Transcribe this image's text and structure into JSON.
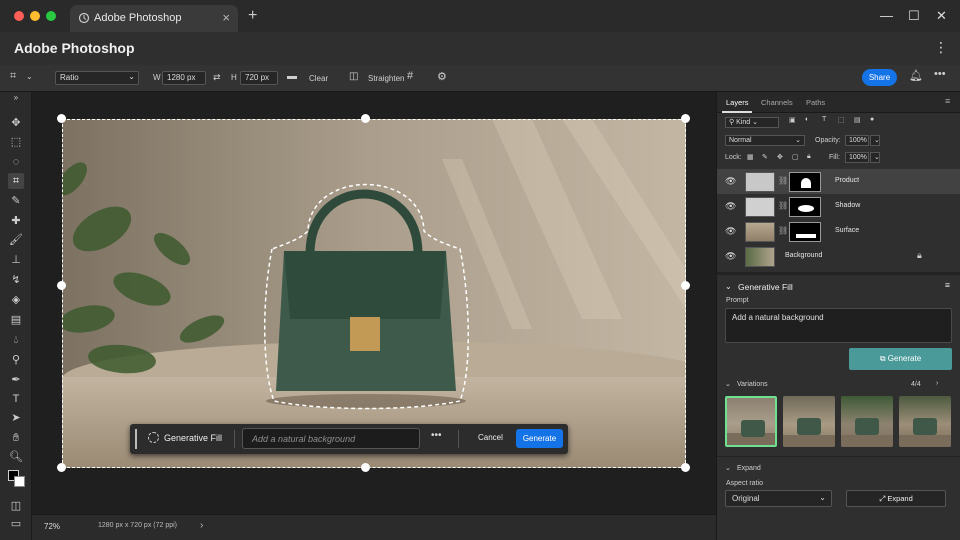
{
  "browser": {
    "tab_title": "Adobe Photoshop",
    "tab_icon": "cloud-icon",
    "new_tab": "+",
    "window_controls": [
      "—",
      "☐",
      "✕"
    ]
  },
  "app": {
    "title": "Adobe Photoshop",
    "menu_icon": "kebab-icon"
  },
  "options_bar": {
    "ratio_label": "Ratio",
    "width_label": "W",
    "width_value": "1280 px",
    "height_label": "H",
    "height_value": "720 px",
    "clear_label": "Clear",
    "straighten_label": "Straighten",
    "share_label": "Share"
  },
  "contextual_task_bar": {
    "label": "Generative Fill",
    "input_placeholder": "Add a natural background",
    "more": "•••",
    "cancel_label": "Cancel",
    "generate_label": "Generate"
  },
  "status_bar": {
    "zoom": "72%",
    "document_info": "1280 px x 720 px (72 ppi)",
    "arrow": "›"
  },
  "layers_panel": {
    "tabs": [
      "Layers",
      "Channels",
      "Paths"
    ],
    "active_tab": "Layers",
    "filter_label": "Kind",
    "blend_mode": "Normal",
    "opacity_label": "Opacity:",
    "opacity_value": "100%",
    "lock_label": "Lock:",
    "fill_label": "Fill:",
    "fill_value": "100%",
    "layers": [
      {
        "name": "Product",
        "selected": true
      },
      {
        "name": "Shadow",
        "selected": false
      },
      {
        "name": "Surface",
        "selected": false
      },
      {
        "name": "Background",
        "selected": false,
        "locked": true
      }
    ]
  },
  "generative_fill": {
    "title": "Generative Fill",
    "prompt_label": "Prompt",
    "prompt_value": "Add a natural background",
    "generate_label": "Generate",
    "variations_label": "Variations",
    "variations_count": "4/4",
    "selected_variation": 1,
    "expand_section_label": "Expand",
    "aspect_ratio_label": "Aspect ratio",
    "aspect_ratio_value": "Original",
    "expand_button_label": "Expand"
  },
  "colors": {
    "accent_blue": "#1473e6",
    "generate_teal": "#4a9a9a",
    "variation_selected": "#6fe08f",
    "mac_red": "#ff5f57",
    "mac_yellow": "#febc2e",
    "mac_green": "#28c840"
  }
}
